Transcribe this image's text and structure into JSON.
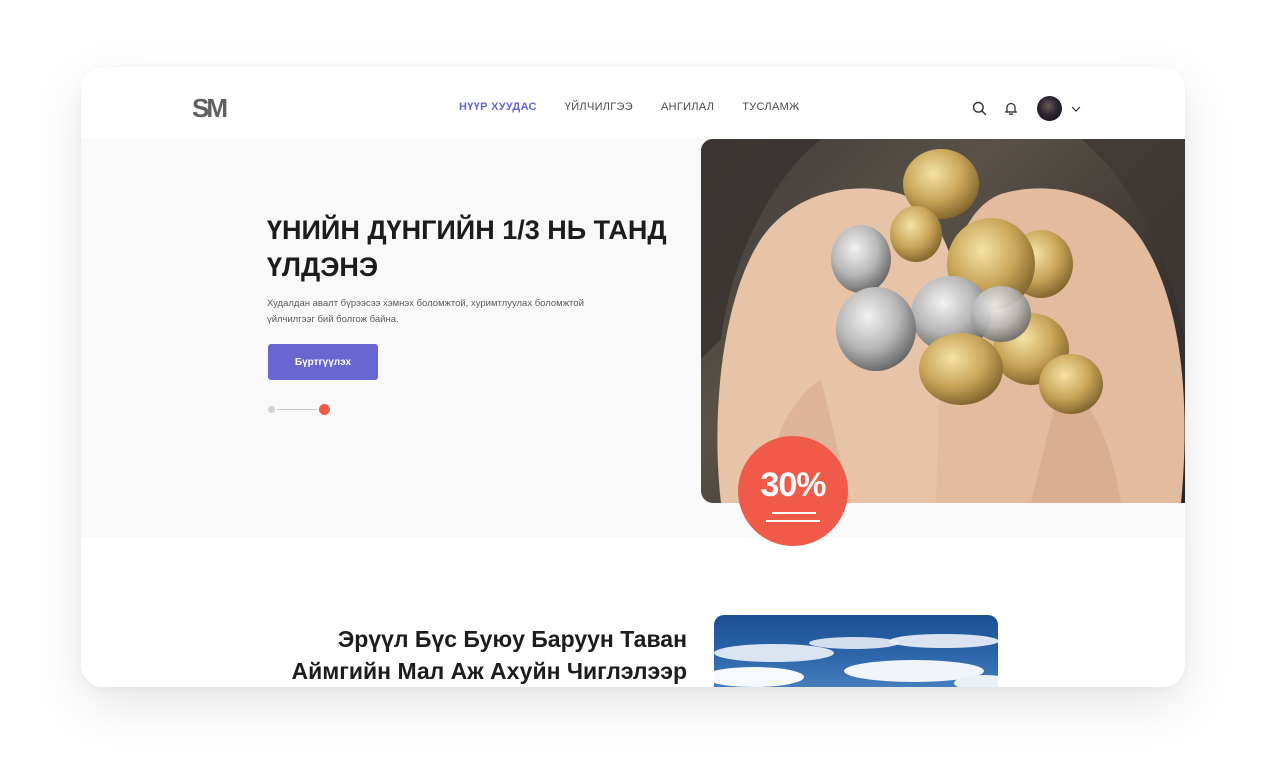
{
  "header": {
    "logo": "SM",
    "nav": [
      {
        "label": "НҮҮР ХУУДАС",
        "active": true
      },
      {
        "label": "ҮЙЛЧИЛГЭЭ",
        "active": false
      },
      {
        "label": "АНГИЛАЛ",
        "active": false
      },
      {
        "label": "ТУСЛАМЖ",
        "active": false
      }
    ],
    "icons": [
      "search-icon",
      "bell-icon",
      "avatar",
      "chevron-down-icon"
    ]
  },
  "hero": {
    "title": "ҮНИЙН ДҮНГИЙН 1/3 НЬ ТАНД ҮЛДЭНЭ",
    "description": "Худалдан авалт бүрээсээ хэмнэх боломжтой, хуримтлуулах боломжтой үйлчилгээг бий болгож байна.",
    "button_label": "Бүртгүүлэх",
    "slider": {
      "count": 2,
      "active_index": 1
    },
    "badge": "30%"
  },
  "section": {
    "title": "Эрүүл Бүс Буюу Баруун Таван Аймгийн Мал Аж Ахуйн Чиглэлээр"
  },
  "colors": {
    "accent": "#6866d0",
    "nav_active": "#6466d6",
    "badge": "#f05a48",
    "hero_bg": "#f9f9f9"
  }
}
